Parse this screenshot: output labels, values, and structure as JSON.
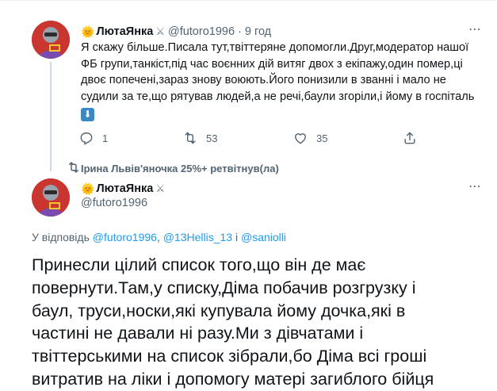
{
  "tweet1": {
    "display_name": "ЛютаЯнка",
    "handle": "@futoro1996",
    "separator": "·",
    "time": "9 год",
    "text_lines": [
      "Я скажу більше.Писала тут,твіттеряне допомогли.Друг,модератор нашої",
      "ФБ групи,танкіст,під час воєнних дій витяг двох з екіпажу,один помер,ці",
      "двоє попечені,зараз знову воюють.Його понизили в званні і мало не",
      "судили за те,що рятував людей,а не речі,баули згоріли,і йому в госпіталь"
    ],
    "emoji": "⬇",
    "replies": "1",
    "retweets": "53",
    "likes": "35"
  },
  "retweet_banner": {
    "text": "Ірина Львів'яночка 25%+ ретвітнув(ла)"
  },
  "tweet2": {
    "display_name": "ЛютаЯнка",
    "handle": "@futoro1996",
    "reply_prefix": "У відповідь",
    "reply_handles": [
      "@futoro1996",
      "@13Hellis_13",
      "@saniolli"
    ],
    "reply_and": "і",
    "text_lines": [
      "Принесли цілий список того,що він де має",
      "повернути.Там,у списку,Діма побачив розгрузку і",
      "баул, труси,носки,які купувала йому дочка,які в",
      "частині не давали ні разу.Ми з дівчатами і",
      "твіттерськими на список зібрали,бо Діма всі гроші",
      "витратив на ліки і допомогу матері загиблого бійця"
    ]
  },
  "icons": {
    "name_prefix": "sun-emoji",
    "name_suffix": "crossed-swords-emoji",
    "reply": "reply-icon",
    "retweet": "retweet-icon",
    "like": "heart-icon",
    "share": "share-icon",
    "more": "more-icon"
  }
}
